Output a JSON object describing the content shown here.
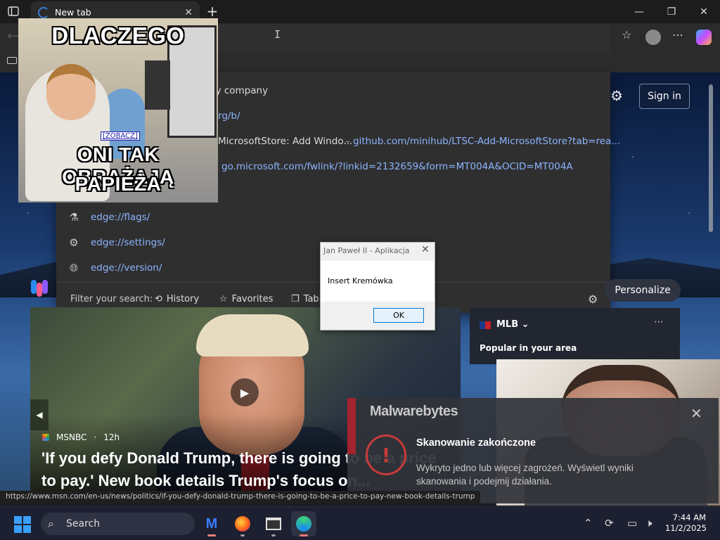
{
  "browser": {
    "tab_title": "New tab",
    "new_tab_symbol": "+",
    "window_controls": {
      "minimize": "—",
      "maximize": "❐",
      "close": "✕"
    },
    "caret_glyph": "I"
  },
  "omnibox_suggestions": [
    {
      "icon": "search-icon",
      "prefix": "",
      "text": "gy company",
      "link": ""
    },
    {
      "icon": "globe-icon",
      "prefix": "",
      "text": "",
      "link": "rg/b/"
    },
    {
      "icon": "globe-icon",
      "prefix": "",
      "text": "MicrosoftStore: Add Windo...",
      "link": "github.com/minihub/LTSC-Add-MicrosoftStore?tab=rea..."
    },
    {
      "icon": "globe-icon",
      "prefix": "",
      "text": "",
      "link": "go.microsoft.com/fwlink/?linkid=2132659&form=MT004A&OCID=MT004A"
    },
    {
      "icon": "flask-icon",
      "prefix": "",
      "text": "",
      "link": "edge://flags/"
    },
    {
      "icon": "gear-icon",
      "prefix": "",
      "text": "",
      "link": "edge://settings/"
    },
    {
      "icon": "globe-icon",
      "prefix": "",
      "text": "",
      "link": "edge://version/"
    }
  ],
  "filter_bar": {
    "label": "Filter your search:",
    "history": "History",
    "favorites": "Favorites",
    "tabs": "Tab"
  },
  "meme": {
    "top": "DLACZEGO",
    "mid": "ONI TAK OBRAŻAJĄ",
    "bot": "PAPIEŻA",
    "link": "[ZOBACZ]"
  },
  "dialog": {
    "title": "Jan Paweł II - Aplikacja",
    "message": "Insert Kremówka",
    "ok_label": "OK"
  },
  "msn": {
    "sign_in": "Sign in",
    "personalize": "Personalize",
    "source": "MSNBC",
    "age": "12h",
    "headline": "'If you defy Donald Trump, there is going to be a price to pay.' New book details Trump's focus on...",
    "mlb_title": "MLB",
    "popular": "Popular in your area"
  },
  "malwarebytes": {
    "brand": "Malwarebytes",
    "title": "Skanowanie zakończone",
    "body": "Wykryto jedno lub więcej zagrożeń. Wyświetl wyniki skanowania i podejmij działania.",
    "alert_glyph": "!"
  },
  "status_url": "https://www.msn.com/en-us/news/politics/if-you-defy-donald-trump-there-is-going-to-be-a-price-to-pay-new-book-details-trump",
  "taskbar": {
    "search_label": "Search",
    "time": "7:44 AM",
    "date": "11/2/2025"
  },
  "colors": {
    "accent_link": "#8cb4ff",
    "malwarebytes_red": "#c8202a",
    "windows_blue": "#3aa0ff"
  }
}
